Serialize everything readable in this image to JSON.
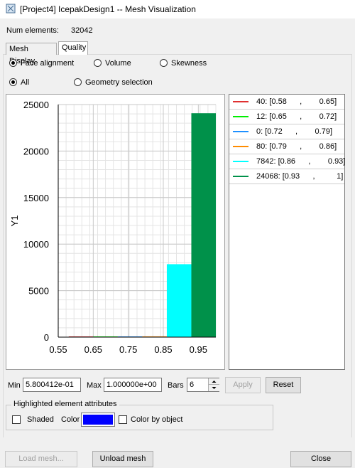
{
  "window": {
    "title": "[Project4] IcepakDesign1 -- Mesh Visualization"
  },
  "stats": {
    "num_elements_label": "Num elements:",
    "num_elements_value": "32042"
  },
  "tabs": [
    {
      "label": "Mesh Display",
      "active": false
    },
    {
      "label": "Quality",
      "active": true
    }
  ],
  "quality_metric": {
    "options": [
      "Face alignment",
      "Volume",
      "Skewness"
    ],
    "selected": "Face alignment"
  },
  "scope": {
    "options": [
      "All",
      "Geometry selection"
    ],
    "selected": "All"
  },
  "chart_data": {
    "type": "bar",
    "ylabel": "Y1",
    "xlabel": "",
    "xlim": [
      0.55,
      1.0
    ],
    "ylim": [
      0,
      25000
    ],
    "xticks": [
      "0.55",
      "0.65",
      "0.75",
      "0.85",
      "0.95"
    ],
    "yticks": [
      "0",
      "5000",
      "10000",
      "15000",
      "20000",
      "25000"
    ],
    "grid": true,
    "bins": [
      {
        "range": [
          0.58,
          0.65
        ],
        "value": 40,
        "color": "#e03030"
      },
      {
        "range": [
          0.65,
          0.72
        ],
        "value": 12,
        "color": "#00ee00"
      },
      {
        "range": [
          0.72,
          0.79
        ],
        "value": 0,
        "color": "#1e90ff"
      },
      {
        "range": [
          0.79,
          0.86
        ],
        "value": 80,
        "color": "#ff8c00"
      },
      {
        "range": [
          0.86,
          0.93
        ],
        "value": 7842,
        "color": "#00ffff"
      },
      {
        "range": [
          0.93,
          1.0
        ],
        "value": 24068,
        "color": "#00914a"
      }
    ]
  },
  "legend": {
    "entries": [
      {
        "text": "40: [0.58      ,        0.65]",
        "color": "#e03030"
      },
      {
        "text": "12: [0.65      ,        0.72]",
        "color": "#00ee00"
      },
      {
        "text": "0: [0.72      ,        0.79]",
        "color": "#1e90ff"
      },
      {
        "text": "80: [0.79      ,        0.86]",
        "color": "#ff8c00"
      },
      {
        "text": "7842: [0.86      ,        0.93]",
        "color": "#00ffff"
      },
      {
        "text": "24068: [0.93      ,          1]",
        "color": "#00914a"
      }
    ]
  },
  "range_controls": {
    "min_label": "Min",
    "min_value": "5.800412e-01",
    "max_label": "Max",
    "max_value": "1.000000e+00",
    "bars_label": "Bars",
    "bars_value": "6",
    "apply_label": "Apply",
    "reset_label": "Reset"
  },
  "highlight": {
    "group_label": "Highlighted element attributes",
    "shaded_label": "Shaded",
    "color_label": "Color",
    "color_value": "#0000ff",
    "color_by_object_label": "Color by object"
  },
  "footer": {
    "load_label": "Load mesh...",
    "unload_label": "Unload mesh",
    "close_label": "Close"
  }
}
